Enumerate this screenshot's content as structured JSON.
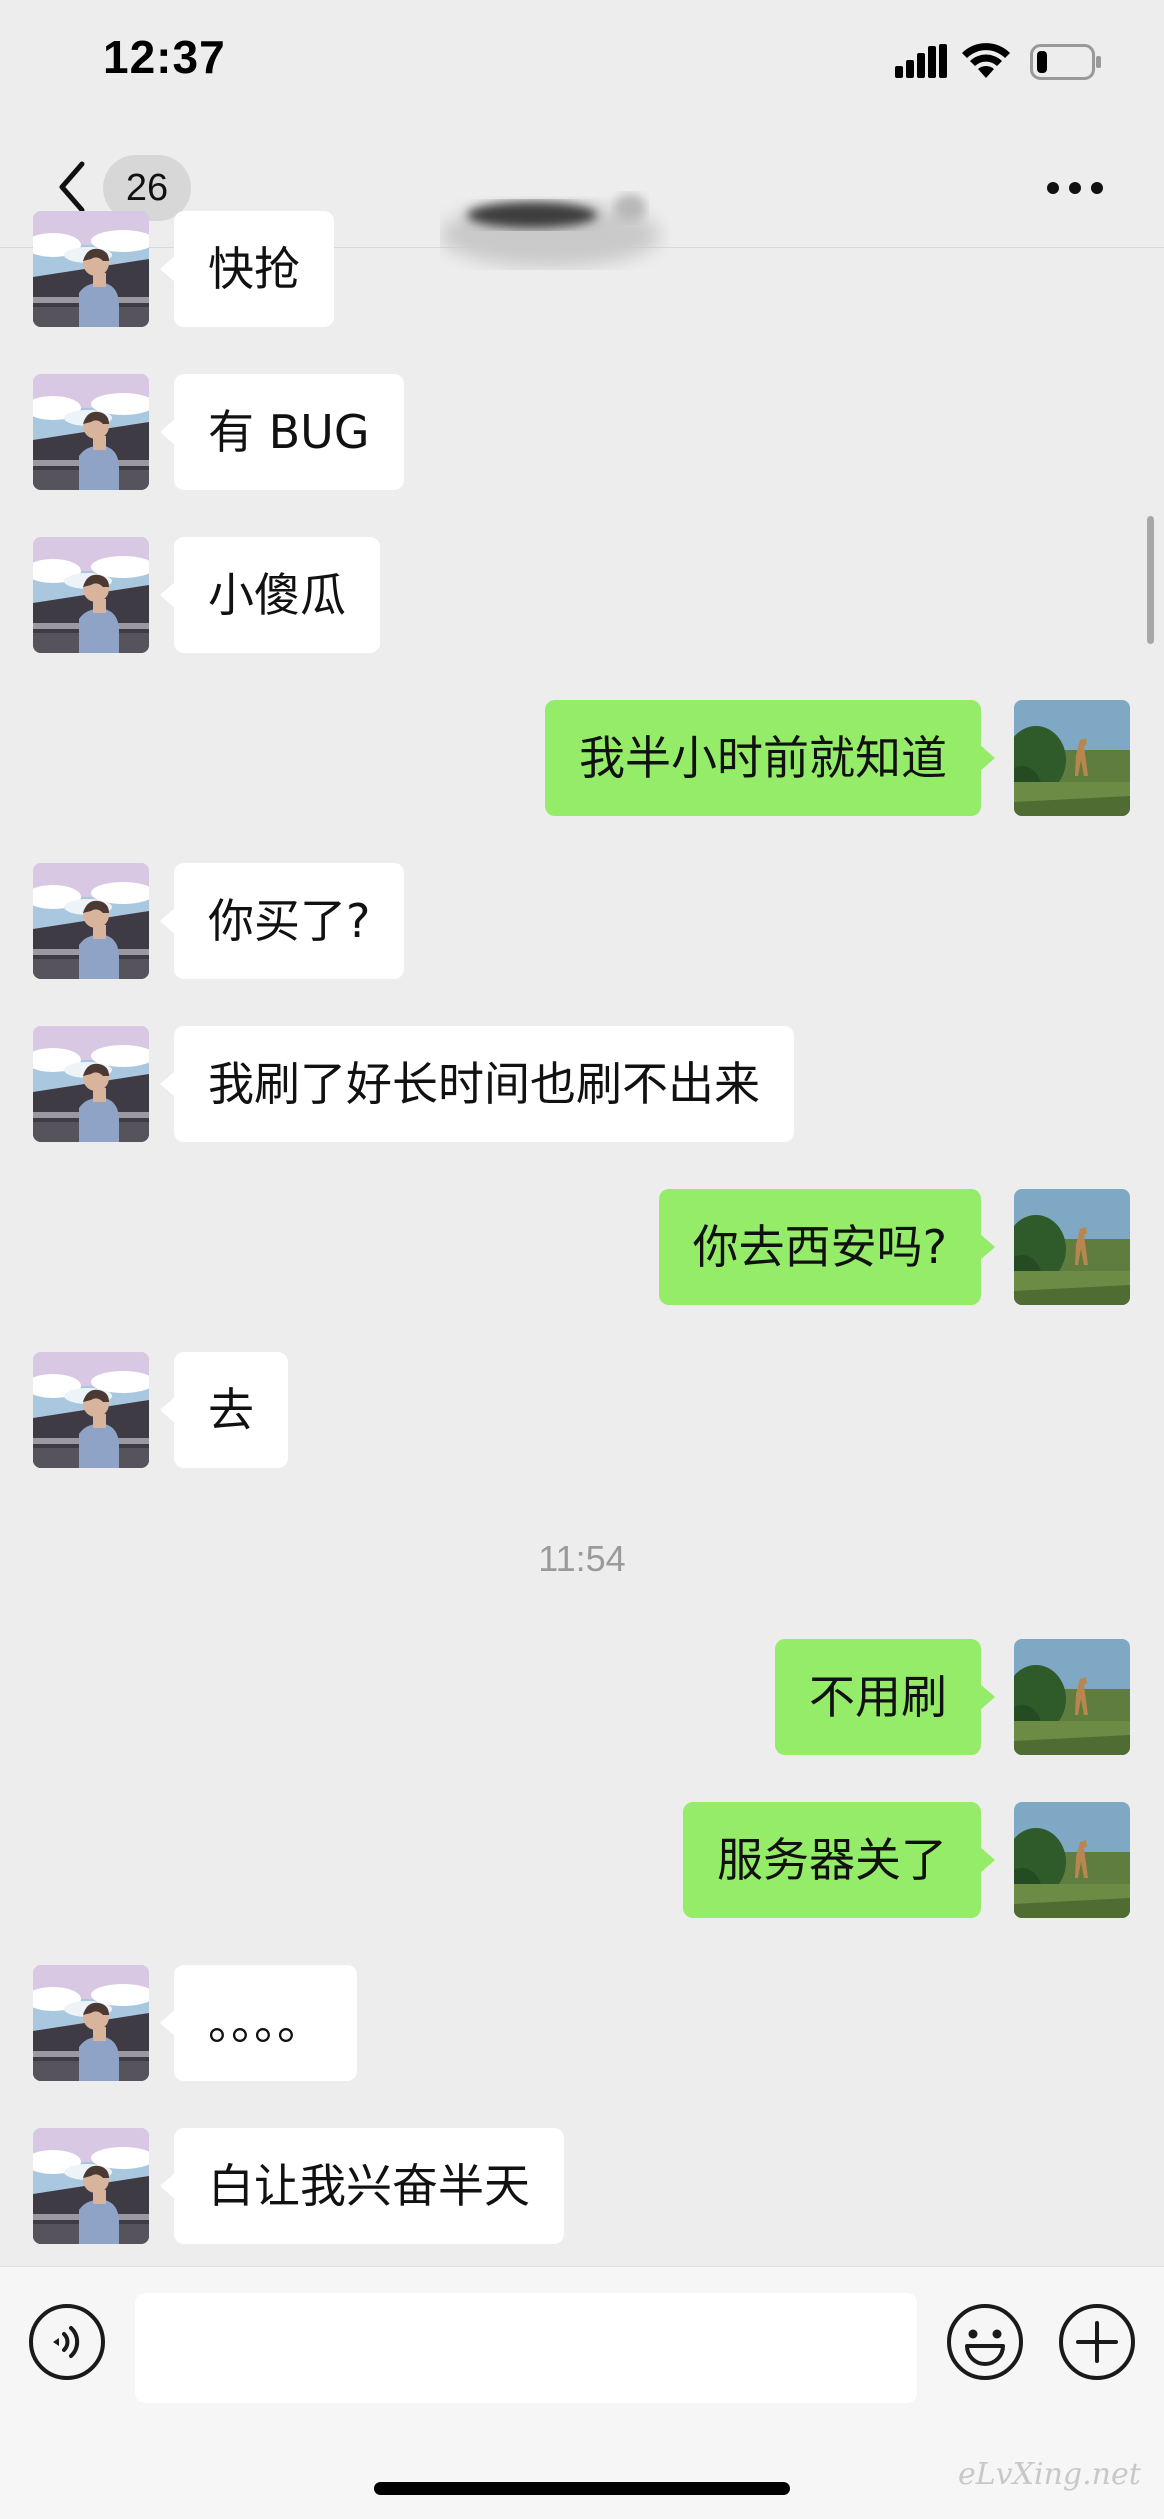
{
  "status_bar": {
    "time": "12:37",
    "icons": [
      "signal-icon",
      "wifi-icon",
      "battery-icon"
    ],
    "battery_level": 0.2
  },
  "nav": {
    "back_icon": "chevron-left-icon",
    "unread_count": "26",
    "more_icon": "more-dots-icon"
  },
  "colors": {
    "background": "#ededed",
    "sent_bubble": "#95ec69",
    "received_bubble": "#ffffff",
    "timestamp": "#9a9a9a"
  },
  "messages": [
    {
      "side": "left",
      "text": "快抢"
    },
    {
      "side": "left",
      "text": "有 BUG"
    },
    {
      "side": "left",
      "text": "小傻瓜"
    },
    {
      "side": "right",
      "text": "我半小时前就知道"
    },
    {
      "side": "left",
      "text": "你买了?"
    },
    {
      "side": "left",
      "text": "我刷了好长时间也刷不出来"
    },
    {
      "side": "right",
      "text": "你去西安吗?"
    },
    {
      "side": "left",
      "text": "去"
    },
    {
      "side": "right",
      "text": "不用刷"
    },
    {
      "side": "right",
      "text": "服务器关了"
    },
    {
      "side": "left",
      "text": "。。。。"
    },
    {
      "side": "left",
      "text": "白让我兴奋半天"
    }
  ],
  "timestamp": "11:54",
  "input_bar": {
    "voice_icon": "voice-icon",
    "input_value": "",
    "emoji_icon": "emoji-icon",
    "add_icon": "plus-icon"
  },
  "watermark": "eLvXing.net"
}
